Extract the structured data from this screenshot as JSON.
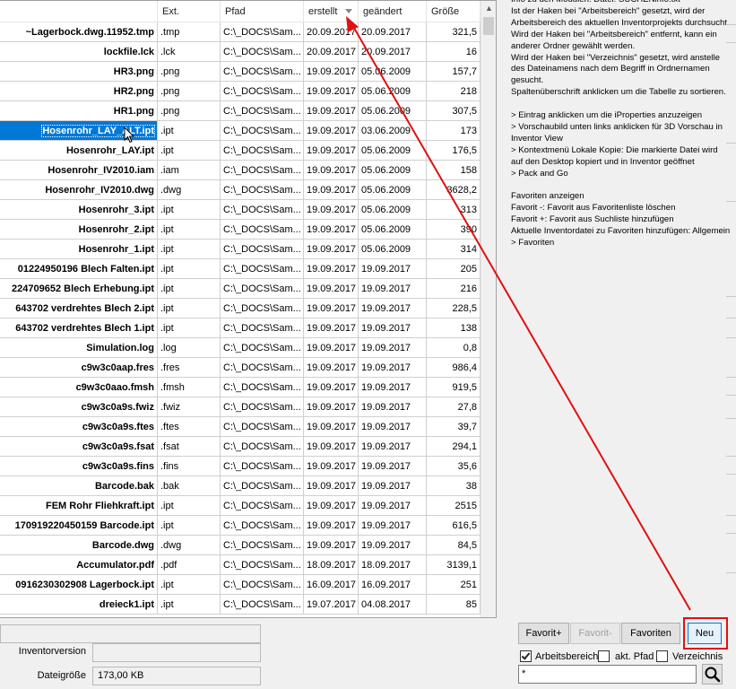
{
  "table": {
    "columns": [
      "",
      "Ext.",
      "Pfad",
      "erstellt",
      "geändert",
      "Größe"
    ],
    "sorted_column": "erstellt",
    "selected_row": 5,
    "rows": [
      [
        "~Lagerbock.dwg.11952.tmp",
        ".tmp",
        "C:\\_DOCS\\Sam...",
        "20.09.2017",
        "20.09.2017",
        "321,5"
      ],
      [
        "lockfile.lck",
        ".lck",
        "C:\\_DOCS\\Sam...",
        "20.09.2017",
        "20.09.2017",
        "16"
      ],
      [
        "HR3.png",
        ".png",
        "C:\\_DOCS\\Sam...",
        "19.09.2017",
        "05.06.2009",
        "157,7"
      ],
      [
        "HR2.png",
        ".png",
        "C:\\_DOCS\\Sam...",
        "19.09.2017",
        "05.06.2009",
        "218"
      ],
      [
        "HR1.png",
        ".png",
        "C:\\_DOCS\\Sam...",
        "19.09.2017",
        "05.06.2009",
        "307,5"
      ],
      [
        "Hosenrohr_LAY_ALT.ipt",
        ".ipt",
        "C:\\_DOCS\\Sam...",
        "19.09.2017",
        "03.06.2009",
        "173"
      ],
      [
        "Hosenrohr_LAY.ipt",
        ".ipt",
        "C:\\_DOCS\\Sam...",
        "19.09.2017",
        "05.06.2009",
        "176,5"
      ],
      [
        "Hosenrohr_IV2010.iam",
        ".iam",
        "C:\\_DOCS\\Sam...",
        "19.09.2017",
        "05.06.2009",
        "158"
      ],
      [
        "Hosenrohr_IV2010.dwg",
        ".dwg",
        "C:\\_DOCS\\Sam...",
        "19.09.2017",
        "05.06.2009",
        "3628,2"
      ],
      [
        "Hosenrohr_3.ipt",
        ".ipt",
        "C:\\_DOCS\\Sam...",
        "19.09.2017",
        "05.06.2009",
        "313"
      ],
      [
        "Hosenrohr_2.ipt",
        ".ipt",
        "C:\\_DOCS\\Sam...",
        "19.09.2017",
        "05.06.2009",
        "390"
      ],
      [
        "Hosenrohr_1.ipt",
        ".ipt",
        "C:\\_DOCS\\Sam...",
        "19.09.2017",
        "05.06.2009",
        "314"
      ],
      [
        "01224950196 Blech Falten.ipt",
        ".ipt",
        "C:\\_DOCS\\Sam...",
        "19.09.2017",
        "19.09.2017",
        "205"
      ],
      [
        "224709652 Blech Erhebung.ipt",
        ".ipt",
        "C:\\_DOCS\\Sam...",
        "19.09.2017",
        "19.09.2017",
        "216"
      ],
      [
        "643702 verdrehtes Blech 2.ipt",
        ".ipt",
        "C:\\_DOCS\\Sam...",
        "19.09.2017",
        "19.09.2017",
        "228,5"
      ],
      [
        "643702 verdrehtes Blech 1.ipt",
        ".ipt",
        "C:\\_DOCS\\Sam...",
        "19.09.2017",
        "19.09.2017",
        "138"
      ],
      [
        "Simulation.log",
        ".log",
        "C:\\_DOCS\\Sam...",
        "19.09.2017",
        "19.09.2017",
        "0,8"
      ],
      [
        "c9w3c0aap.fres",
        ".fres",
        "C:\\_DOCS\\Sam...",
        "19.09.2017",
        "19.09.2017",
        "986,4"
      ],
      [
        "c9w3c0aao.fmsh",
        ".fmsh",
        "C:\\_DOCS\\Sam...",
        "19.09.2017",
        "19.09.2017",
        "919,5"
      ],
      [
        "c9w3c0a9s.fwiz",
        ".fwiz",
        "C:\\_DOCS\\Sam...",
        "19.09.2017",
        "19.09.2017",
        "27,8"
      ],
      [
        "c9w3c0a9s.ftes",
        ".ftes",
        "C:\\_DOCS\\Sam...",
        "19.09.2017",
        "19.09.2017",
        "39,7"
      ],
      [
        "c9w3c0a9s.fsat",
        ".fsat",
        "C:\\_DOCS\\Sam...",
        "19.09.2017",
        "19.09.2017",
        "294,1"
      ],
      [
        "c9w3c0a9s.fins",
        ".fins",
        "C:\\_DOCS\\Sam...",
        "19.09.2017",
        "19.09.2017",
        "35,6"
      ],
      [
        "Barcode.bak",
        ".bak",
        "C:\\_DOCS\\Sam...",
        "19.09.2017",
        "19.09.2017",
        "38"
      ],
      [
        "FEM Rohr Fliehkraft.ipt",
        ".ipt",
        "C:\\_DOCS\\Sam...",
        "19.09.2017",
        "19.09.2017",
        "2515"
      ],
      [
        "170919220450159 Barcode.ipt",
        ".ipt",
        "C:\\_DOCS\\Sam...",
        "19.09.2017",
        "19.09.2017",
        "616,5"
      ],
      [
        "Barcode.dwg",
        ".dwg",
        "C:\\_DOCS\\Sam...",
        "19.09.2017",
        "19.09.2017",
        "84,5"
      ],
      [
        "Accumulator.pdf",
        ".pdf",
        "C:\\_DOCS\\Sam...",
        "18.09.2017",
        "18.09.2017",
        "3139,1"
      ],
      [
        "0916230302908 Lagerbock.ipt",
        ".ipt",
        "C:\\_DOCS\\Sam...",
        "16.09.2017",
        "16.09.2017",
        "251"
      ],
      [
        "dreieck1.ipt",
        ".ipt",
        "C:\\_DOCS\\Sam...",
        "19.07.2017",
        "04.08.2017",
        "85"
      ]
    ]
  },
  "details": {
    "field1_value": "",
    "inventor_label": "Inventorversion",
    "inventor_value": "",
    "size_label": "Dateigröße",
    "size_value": "173,00 KB"
  },
  "info_text": "Info zu den Modulen. Datei: SUCHENinfo.txt\nIst der Haken bei \"Arbeitsbereich\" gesetzt, wird der Arbeitsbereich des aktuellen Inventorprojekts durchsucht.\nWird der Haken bei \"Arbeitsbereich\" entfernt, kann ein anderer Ordner gewählt werden.\nWird der Haken bei \"Verzeichnis\" gesetzt, wird anstelle des Dateinamens nach dem Begriff in Ordnernamen gesucht.\nSpaltenüberschrift anklicken um die Tabelle zu sortieren.\n\n> Eintrag anklicken um die iProperties anzuzeigen\n> Vorschaubild unten links anklicken für 3D Vorschau in Inventor View\n> Kontextmenü Lokale Kopie: Die markierte Datei wird auf den Desktop kopiert und in Inventor geöffnet\n> Pack and Go\n\nFavoriten anzeigen\nFavorit -: Favorit aus Favoritenliste löschen\nFavorit +: Favorit aus Suchliste hinzufügen\nAktuelle Inventordatei zu Favoriten hinzufügen: Allgemein > Favoriten",
  "buttons": {
    "fav_plus": "Favorit+",
    "fav_minus": "Favorit-",
    "favorites": "Favoriten",
    "new": "Neu"
  },
  "checkboxes": {
    "workspace": {
      "label": "Arbeitsbereich",
      "checked": true
    },
    "active_path": {
      "label": "akt. Pfad",
      "checked": false
    },
    "directory": {
      "label": "Verzeichnis",
      "checked": false
    }
  },
  "search": {
    "value": "*"
  },
  "annotation": {
    "color": "#e01010"
  }
}
